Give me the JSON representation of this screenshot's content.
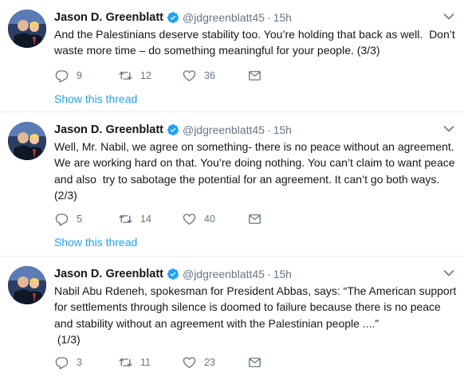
{
  "tweets": [
    {
      "name": "Jason D. Greenblatt",
      "handle": "@jdgreenblatt45",
      "separator": "·",
      "time": "15h",
      "text": "And the Palestinians deserve stability too. You’re holding that back as well.  Don’t waste more time – do something meaningful for your people. (3/3)",
      "replies": "9",
      "retweets": "12",
      "likes": "36",
      "show_thread": "Show this thread"
    },
    {
      "name": "Jason D. Greenblatt",
      "handle": "@jdgreenblatt45",
      "separator": "·",
      "time": "15h",
      "text": "Well, Mr. Nabil, we agree on something- there is no peace without an agreement. We are working hard on that. You’re doing nothing. You can’t claim to want peace and also  try to sabotage the potential for an agreement. It can’t go both ways. (2/3)",
      "replies": "5",
      "retweets": "14",
      "likes": "40",
      "show_thread": "Show this thread"
    },
    {
      "name": "Jason D. Greenblatt",
      "handle": "@jdgreenblatt45",
      "separator": "·",
      "time": "15h",
      "text": "Nabil Abu Rdeneh, spokesman for President Abbas, says: “The American support for settlements through silence is doomed to failure because there is no peace and stability without an agreement with the Palestinian people ....”\n (1/3)",
      "replies": "3",
      "retweets": "11",
      "likes": "23"
    }
  ],
  "colors": {
    "text": "#14171a",
    "secondary": "#657786",
    "link": "#1da1f2",
    "verified": "#1da1f2",
    "divider": "#e6ecf0"
  },
  "icons": [
    "reply-icon",
    "retweet-icon",
    "like-icon",
    "direct-message-icon",
    "verified-badge-icon",
    "chevron-down-icon"
  ]
}
